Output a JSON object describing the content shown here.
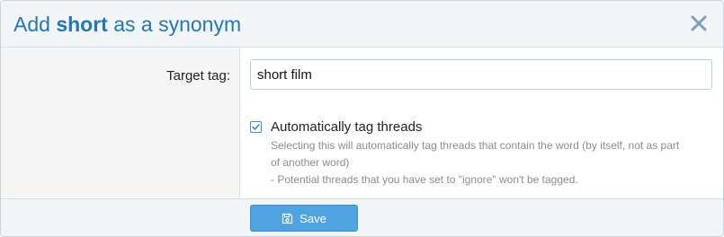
{
  "dialog": {
    "title_prefix": "Add ",
    "title_term": "short",
    "title_suffix": " as a synonym",
    "close_icon": "close-icon"
  },
  "form": {
    "target_tag_label": "Target tag:",
    "target_tag_value": "short film",
    "auto_tag": {
      "checked": true,
      "label": "Automatically tag threads",
      "hint_lines": [
        "Selecting this will automatically tag threads that contain the word (by itself, not as part",
        "of another word)",
        "- Potential threads that you have set to \"ignore\" won't be tagged."
      ]
    }
  },
  "footer": {
    "save_label": "Save",
    "save_icon": "save-icon"
  },
  "colors": {
    "accent": "#2577b1",
    "button": "#4fa3e0",
    "hint": "#8c8c8c"
  }
}
